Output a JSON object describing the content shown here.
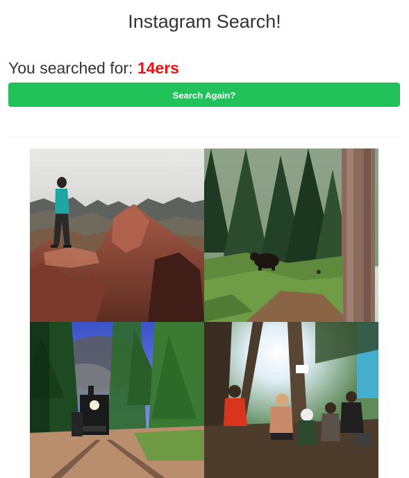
{
  "header": {
    "title": "Instagram Search!"
  },
  "search": {
    "prefix": "You searched for: ",
    "term": "14ers",
    "term_color": "#ee1111"
  },
  "actions": {
    "search_again_label": "Search Again?",
    "button_color": "#21c25a"
  },
  "results": {
    "photos": [
      {
        "name": "photo-hiker-on-summit"
      },
      {
        "name": "photo-bear-in-forest"
      },
      {
        "name": "photo-steam-train"
      },
      {
        "name": "photo-group-of-hikers"
      }
    ]
  }
}
